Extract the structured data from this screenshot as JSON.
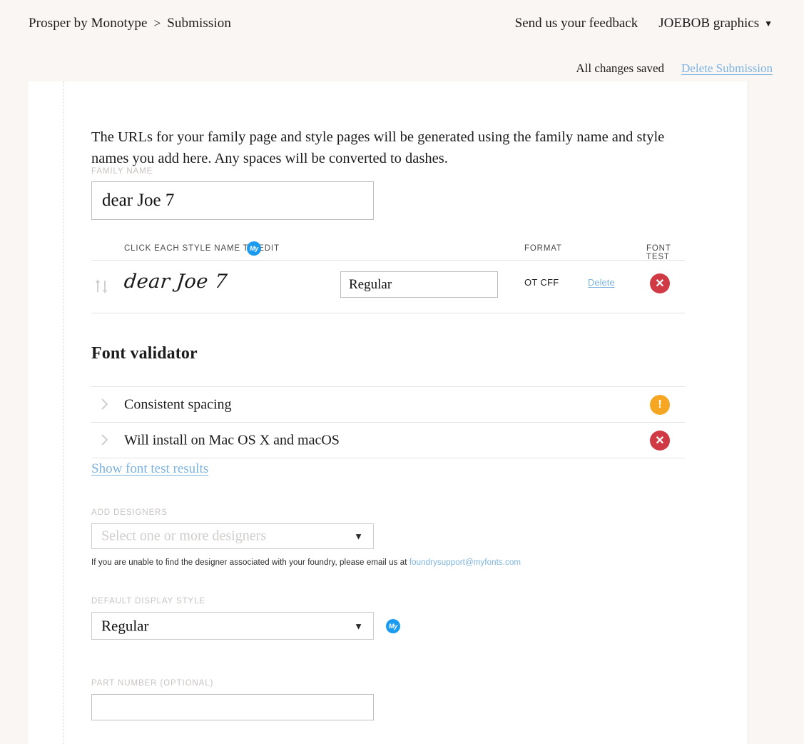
{
  "topbar": {
    "breadcrumb": {
      "root": "Prosper by Monotype",
      "separator": ">",
      "current": "Submission"
    },
    "feedback_label": "Send us your feedback",
    "account_label": "JOEBOB graphics",
    "account_caret": "▼"
  },
  "savebar": {
    "status": "All changes saved",
    "delete_label": "Delete Submission"
  },
  "main": {
    "intro": "The URLs for your family page and style pages will be generated using the family name and style names you add here. Any spaces will be converted to dashes.",
    "family": {
      "label": "FAMILY NAME",
      "value": "dear Joe 7",
      "placeholder": ""
    },
    "style_table": {
      "hint": "CLICK EACH STYLE NAME TO EDIT",
      "col_format": "FORMAT",
      "col_font_test": "FONT TEST",
      "rows": [
        {
          "sample": "dear Joe 7",
          "style_name": "Regular",
          "format": "OT CFF",
          "delete_label": "Delete",
          "font_test_status": "error",
          "font_test_glyph": "✕"
        }
      ]
    },
    "validator": {
      "title": "Font validator",
      "rows": [
        {
          "label": "Consistent spacing",
          "status": "warn",
          "glyph": "!"
        },
        {
          "label": "Will install on Mac OS X and macOS",
          "status": "error",
          "glyph": "✕"
        }
      ],
      "show_results_label": "Show font test results"
    },
    "designers": {
      "label": "ADD DESIGNERS",
      "placeholder": "Select one or more designers",
      "caret": "▼",
      "helper_prefix": "If you are unable to find the designer associated with your foundry, please email us at ",
      "helper_email": "foundrysupport@myfonts.com"
    },
    "default_display_style": {
      "label": "DEFAULT DISPLAY STYLE",
      "value": "Regular",
      "caret": "▼"
    },
    "part_number": {
      "label": "PART NUMBER (OPTIONAL)",
      "value": "",
      "placeholder": ""
    }
  },
  "colors": {
    "page_background": "#faf6f4",
    "card_background": "#ffffff",
    "link_blue": "#7cb3e0",
    "badge_blue": "#1b9bf0",
    "error_red": "#cf3a44",
    "warn_orange": "#f5a623",
    "label_gray": "#c9c3c1"
  }
}
